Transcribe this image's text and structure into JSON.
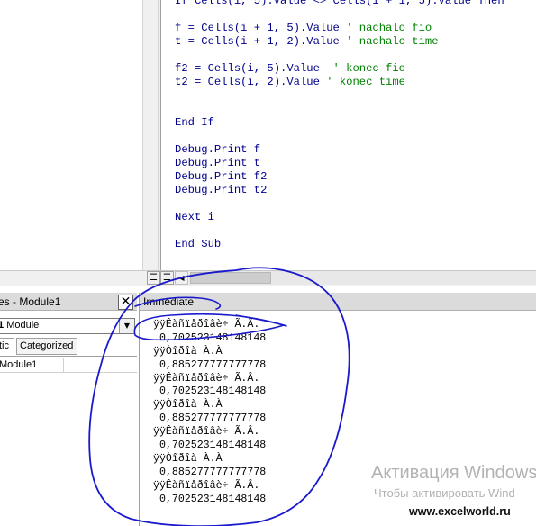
{
  "code_editor": {
    "lines": [
      {
        "code": "If Cells(i, 5).Value <> Cells(i + 1, 5).Value Then",
        "comment": ""
      },
      {
        "code": "",
        "comment": ""
      },
      {
        "code": "f = Cells(i + 1, 5).Value ",
        "comment": "' nachalo fio"
      },
      {
        "code": "t = Cells(i + 1, 2).Value ",
        "comment": "' nachalo time"
      },
      {
        "code": "",
        "comment": ""
      },
      {
        "code": "f2 = Cells(i, 5).Value  ",
        "comment": "' konec fio"
      },
      {
        "code": "t2 = Cells(i, 2).Value ",
        "comment": "' konec time"
      },
      {
        "code": "",
        "comment": ""
      },
      {
        "code": "",
        "comment": ""
      },
      {
        "code": "End If",
        "comment": ""
      },
      {
        "code": "",
        "comment": ""
      },
      {
        "code": "Debug.Print f",
        "comment": ""
      },
      {
        "code": "Debug.Print t",
        "comment": ""
      },
      {
        "code": "Debug.Print f2",
        "comment": ""
      },
      {
        "code": "Debug.Print t2",
        "comment": ""
      },
      {
        "code": "",
        "comment": ""
      },
      {
        "code": "Next i",
        "comment": ""
      },
      {
        "code": "",
        "comment": ""
      },
      {
        "code": "End Sub",
        "comment": ""
      }
    ],
    "view_buttons": {
      "procedure_view": "☰",
      "full_module_view": "☰"
    },
    "scroll_left_arrow": "◀"
  },
  "properties": {
    "title": "es - Module1",
    "close_glyph": "✕",
    "object_name": "1",
    "object_type": "Module",
    "dropdown_glyph": "▼",
    "tabs": {
      "alphabetic": "tic",
      "categorized": "Categorized"
    },
    "row_label": "Module1"
  },
  "immediate": {
    "title": "Immediate",
    "lines": [
      "ÿÿÊàñïåðîâè÷ Ã.Â.",
      " 0,702523148148148",
      "ÿÿÒîðîà À.À",
      " 0,885277777777778",
      "ÿÿÊàñïåðîâè÷ Ã.Â.",
      " 0,702523148148148",
      "ÿÿÒîðîà À.À",
      " 0,885277777777778",
      "ÿÿÊàñïåðîâè÷ Ã.Â.",
      " 0,702523148148148",
      "ÿÿÒîðîà À.À",
      " 0,885277777777778",
      "ÿÿÊàñïåðîâè÷ Ã.Â.",
      " 0,702523148148148"
    ]
  },
  "watermark": {
    "title": "Активация Windows",
    "subtitle": "Чтобы активировать Wind"
  },
  "site": "www.excelworld.ru",
  "colors": {
    "code_text": "#00008b",
    "comment": "#008000",
    "scribble": "#1a1acc",
    "panel_title_bg": "#dbdbdb"
  }
}
